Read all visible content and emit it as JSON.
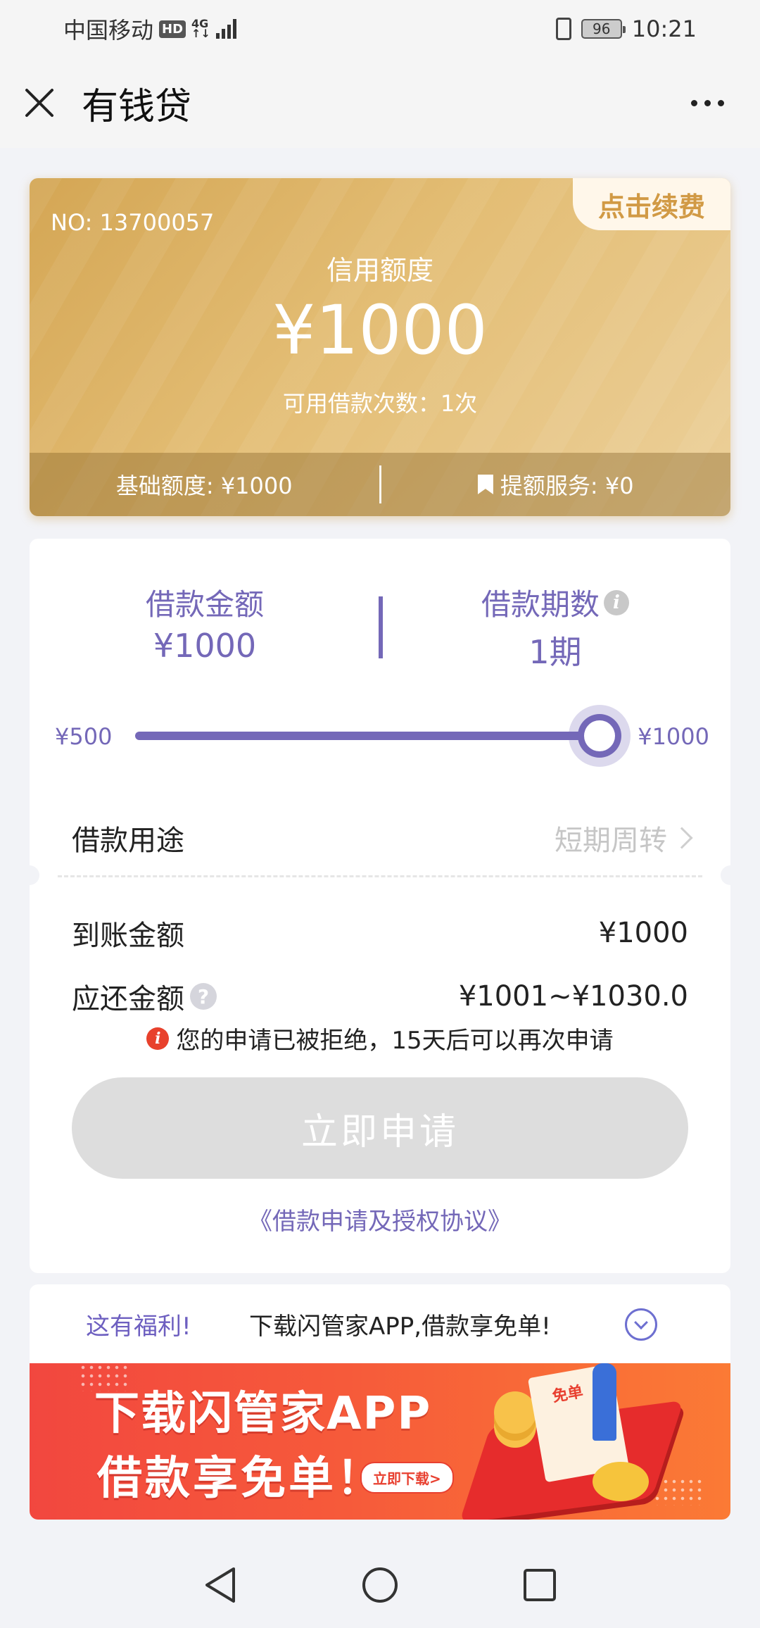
{
  "status_bar": {
    "carrier": "中国移动",
    "hd": "HD",
    "network": "4G",
    "battery": "96",
    "time": "10:21"
  },
  "header": {
    "title": "有钱贷",
    "close_icon": "close-icon",
    "more_icon": "more-dots-icon"
  },
  "credit_card": {
    "renew_label": "点击续费",
    "card_no": "NO: 13700057",
    "credit_label": "信用额度",
    "credit_amount": "¥1000",
    "available_times": "可用借款次数：1次",
    "base_quota": "基础额度: ¥1000",
    "boost_service": "提额服务: ¥0",
    "colors": {
      "gold_start": "#d4a654",
      "gold_end": "#ecd09a"
    }
  },
  "loan": {
    "amount_label": "借款金额",
    "amount_value": "¥1000",
    "period_label": "借款期数",
    "period_value": "1期",
    "slider_min": "¥500",
    "slider_max": "¥1000",
    "slider_value_fraction": 1.0,
    "purpose_label": "借款用途",
    "purpose_value": "短期周转",
    "received_label": "到账金额",
    "received_value": "¥1000",
    "repay_label": "应还金额",
    "repay_value": "¥1001~¥1030.0",
    "reject_notice": "您的申请已被拒绝，15天后可以再次申请",
    "apply_button": "立即申请",
    "agreement_link": "《借款申请及授权协议》",
    "accent_color": "#7468b8"
  },
  "promo": {
    "tag": "这有福利!",
    "text": "下载闪管家APP,借款享免单!",
    "banner_line1": "下载闪管家APP",
    "banner_line2": "借款享免单！",
    "banner_cta": "立即下载>",
    "banner_paper": "免单"
  }
}
